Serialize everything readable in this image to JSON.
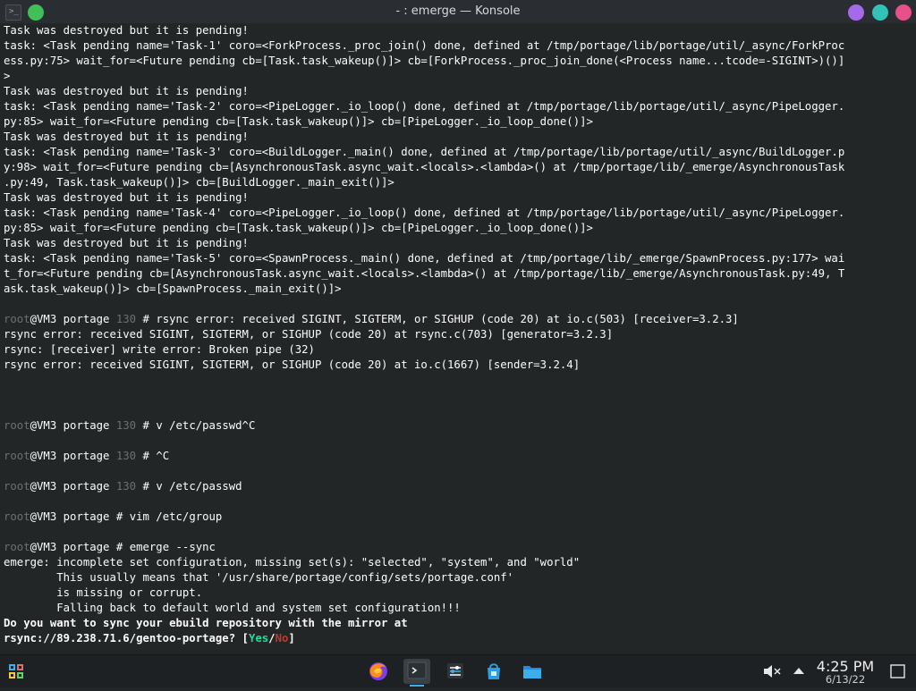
{
  "window": {
    "title": "- : emerge — Konsole"
  },
  "terminal": {
    "lines": [
      "Task was destroyed but it is pending!",
      "task: <Task pending name='Task-1' coro=<ForkProcess._proc_join() done, defined at /tmp/portage/lib/portage/util/_async/ForkProc",
      "ess.py:75> wait_for=<Future pending cb=[Task.task_wakeup()]> cb=[ForkProcess._proc_join_done(<Process name...tcode=-SIGINT>)()]",
      ">",
      "Task was destroyed but it is pending!",
      "task: <Task pending name='Task-2' coro=<PipeLogger._io_loop() done, defined at /tmp/portage/lib/portage/util/_async/PipeLogger.",
      "py:85> wait_for=<Future pending cb=[Task.task_wakeup()]> cb=[PipeLogger._io_loop_done()]>",
      "Task was destroyed but it is pending!",
      "task: <Task pending name='Task-3' coro=<BuildLogger._main() done, defined at /tmp/portage/lib/portage/util/_async/BuildLogger.p",
      "y:98> wait_for=<Future pending cb=[AsynchronousTask.async_wait.<locals>.<lambda>() at /tmp/portage/lib/_emerge/AsynchronousTask",
      ".py:49, Task.task_wakeup()]> cb=[BuildLogger._main_exit()]>",
      "Task was destroyed but it is pending!",
      "task: <Task pending name='Task-4' coro=<PipeLogger._io_loop() done, defined at /tmp/portage/lib/portage/util/_async/PipeLogger.",
      "py:85> wait_for=<Future pending cb=[Task.task_wakeup()]> cb=[PipeLogger._io_loop_done()]>",
      "Task was destroyed but it is pending!",
      "task: <Task pending name='Task-5' coro=<SpawnProcess._main() done, defined at /tmp/portage/lib/_emerge/SpawnProcess.py:177> wai",
      "t_for=<Future pending cb=[AsynchronousTask.async_wait.<locals>.<lambda>() at /tmp/portage/lib/_emerge/AsynchronousTask.py:49, T",
      "ask.task_wakeup()]> cb=[SpawnProcess._main_exit()]>"
    ],
    "prompt": {
      "user": "root",
      "host": "@VM3 portage",
      "code": "130",
      "symbol": "#"
    },
    "cmd1": "rsync error: received SIGINT, SIGTERM, or SIGHUP (code 20) at io.c(503) [receiver=3.2.3]",
    "rsync_lines": [
      "rsync error: received SIGINT, SIGTERM, or SIGHUP (code 20) at rsync.c(703) [generator=3.2.3]",
      "rsync: [receiver] write error: Broken pipe (32)",
      "rsync error: received SIGINT, SIGTERM, or SIGHUP (code 20) at io.c(1667) [sender=3.2.4]"
    ],
    "cmd2": "v /etc/passwd^C",
    "cmd3": "^C",
    "cmd4": "v /etc/passwd",
    "cmd5": "vim /etc/group",
    "cmd6": "emerge --sync",
    "emerge_lines": [
      "emerge: incomplete set configuration, missing set(s): \"selected\", \"system\", and \"world\"",
      "        This usually means that '/usr/share/portage/config/sets/portage.conf'",
      "        is missing or corrupt.",
      "        Falling back to default world and system set configuration!!!"
    ],
    "question": "Do you want to sync your ebuild repository with the mirror at",
    "mirror": "rsync://89.238.71.6/gentoo-portage",
    "q_mark": "? [",
    "yes": "Yes",
    "slash": "/",
    "no": "No",
    "close_bracket": "]"
  },
  "taskbar": {
    "icons": [
      "app-launcher-icon",
      "firefox-icon",
      "konsole-icon",
      "system-settings-icon",
      "discover-store-icon",
      "dolphin-files-icon"
    ],
    "tray": [
      "volume-muted-icon",
      "show-hidden-icon",
      "show-desktop-icon"
    ],
    "time": "4:25 PM",
    "date": "6/13/22"
  },
  "colors": {
    "accent": "#3daee9",
    "yes": "#1cdc9a",
    "no": "#c0392b",
    "prompt_dim": "#6c7075"
  }
}
